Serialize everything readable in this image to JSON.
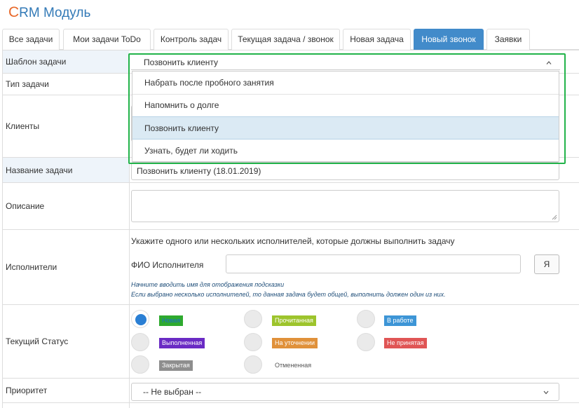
{
  "app": {
    "title_first": "C",
    "title_rest": "RM Модуль"
  },
  "tabs": [
    {
      "label": "Все задачи"
    },
    {
      "label": "Мои задачи ToDo"
    },
    {
      "label": "Контроль задач"
    },
    {
      "label": "Текущая задача / звонок"
    },
    {
      "label": "Новая задача"
    },
    {
      "label": "Новый звонок",
      "active": true
    },
    {
      "label": "Заявки"
    }
  ],
  "form": {
    "template_label": "Шаблон задачи",
    "template_value": "Позвонить клиенту",
    "template_options": [
      "Набрать после пробного занятия",
      "Напомнить о долге",
      "Позвонить клиенту",
      "Узнать, будет ли ходить"
    ],
    "type_label": "Тип задачи",
    "clients_label": "Клиенты",
    "name_label": "Название задачи",
    "name_value": "Позвонить клиенту  (18.01.2019)",
    "description_label": "Описание",
    "executors_label": "Исполнители",
    "executors_note": "Укажите одного или нескольких исполнителей, которые должны выполнить задачу",
    "executor_field_label": "ФИО Исполнителя",
    "executor_button": "Я",
    "hint_1": "Начните вводить имя для отображения подсказки",
    "hint_2": "Если выбрано несколько исполнителей, то данная задача будет общей, выполнить должен один из них.",
    "status_label": "Текущий Статус",
    "statuses": [
      {
        "label": "Новая",
        "color": "#2eaa2e",
        "checked": true
      },
      {
        "label": "Прочитанная",
        "color": "#9dc42c"
      },
      {
        "label": "В работе",
        "color": "#3d95d6"
      },
      {
        "label": "Выполненная",
        "color": "#6a2bc4"
      },
      {
        "label": "На уточнении",
        "color": "#e0913a"
      },
      {
        "label": "Не принятая",
        "color": "#e05555"
      },
      {
        "label": "Закрытая",
        "color": "#8e8e8e"
      },
      {
        "label": "Отмененная",
        "color": ""
      }
    ],
    "priority_label": "Приоритет",
    "priority_value": "-- Не выбран --"
  },
  "colors": {
    "accent": "#428bca",
    "highlight": "#22b34a",
    "brand_first": "#e8692a"
  }
}
